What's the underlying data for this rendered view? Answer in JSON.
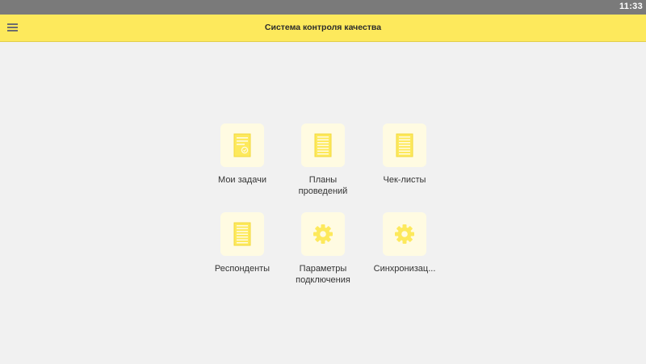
{
  "status_bar": {
    "time": "11:33"
  },
  "header": {
    "title": "Система контроля качества",
    "menu_icon": "menu-icon"
  },
  "colors": {
    "accent": "#fde95c",
    "icon_fill": "#fde95c",
    "icon_bg": "#fffbe2",
    "background": "#f1f1f1"
  },
  "menu": {
    "items": [
      {
        "label": "Мои задачи",
        "icon": "task-document-icon"
      },
      {
        "label": "Планы\nпроведений",
        "icon": "list-document-icon"
      },
      {
        "label": "Чек-листы",
        "icon": "list-document-icon"
      },
      {
        "label": "Респонденты",
        "icon": "list-document-icon"
      },
      {
        "label": "Параметры\nподключения",
        "icon": "gear-icon"
      },
      {
        "label": "Синхронизац...",
        "icon": "gear-icon"
      }
    ]
  }
}
